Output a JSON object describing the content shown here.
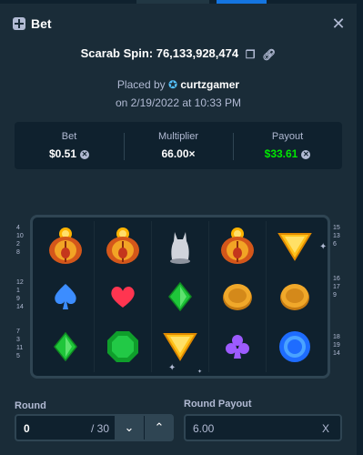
{
  "header": {
    "title": "Bet",
    "icon": "bet-receipt-icon",
    "close_icon": "close-icon"
  },
  "spin": {
    "text": "Scarab Spin: 76,133,928,474",
    "copy_icon": "copy-icon",
    "link_icon": "link-icon"
  },
  "placed": {
    "prefix": "Placed by",
    "username": "curtzgamer",
    "user_icon": "star-badge-icon",
    "date": "on 2/19/2022 at 10:33 PM"
  },
  "stats": {
    "bet_label": "Bet",
    "bet_value": "$0.51",
    "multiplier_label": "Multiplier",
    "multiplier_value": "66.00×",
    "payout_label": "Payout",
    "payout_value": "$33.61",
    "currency_icon": "currency-coin-icon",
    "payout_color": "#00e701"
  },
  "paylines": {
    "left": [
      [
        "4",
        "10",
        "2",
        "8"
      ],
      [
        "12",
        "1",
        "9",
        "14"
      ],
      [
        "7",
        "3",
        "11",
        "5"
      ]
    ],
    "right": [
      [
        "15",
        "13",
        "6"
      ],
      [
        "16",
        "17",
        "9"
      ],
      [
        "18",
        "19",
        "14"
      ]
    ]
  },
  "board": {
    "rows": [
      [
        "scarab",
        "scarab",
        "cat-statue",
        "scarab",
        "yellow-triangle"
      ],
      [
        "blue-spade",
        "red-heart",
        "green-diamond",
        "gold-coin",
        "gold-coin"
      ],
      [
        "green-diamond",
        "green-octagon",
        "yellow-triangle",
        "purple-club",
        "blue-ring"
      ]
    ]
  },
  "round": {
    "label": "Round",
    "value": "0",
    "total": "/ 30",
    "down_icon": "chevron-down-icon",
    "up_icon": "chevron-up-icon"
  },
  "round_payout": {
    "label": "Round Payout",
    "value": "6.00",
    "clear_label": "X"
  },
  "colors": {
    "modal_bg": "#1a2c38",
    "panel_bg": "#0f212e",
    "accent_blue": "#1475e1",
    "win_green": "#00e701"
  }
}
